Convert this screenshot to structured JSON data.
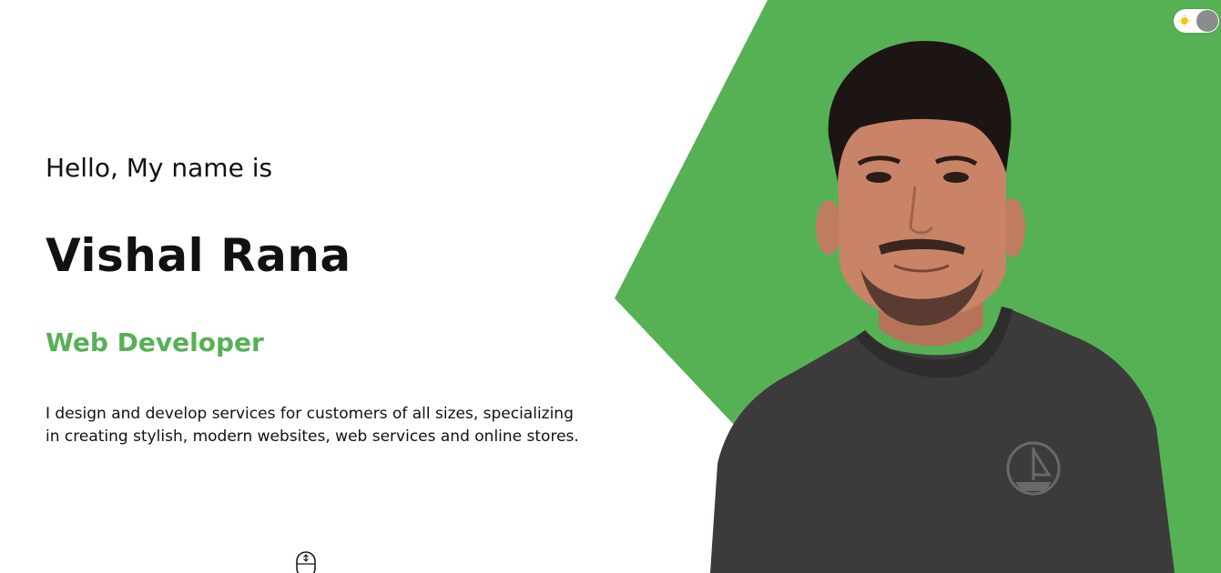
{
  "hero": {
    "greeting": "Hello, My name is",
    "name": "Vishal Rana",
    "role": "Web Developer",
    "description": "I design and develop services for customers of all sizes, specializing in creating stylish, modern websites, web services and online stores."
  },
  "theme_toggle": {
    "icon": "sun-icon",
    "state": "light"
  },
  "scroll_indicator": {
    "icon": "mouse-scroll-icon"
  },
  "colors": {
    "accent": "#56b155",
    "text": "#111111",
    "background": "#ffffff",
    "shirt": "#3d3a3c",
    "toggle_knob": "#8c8c8c"
  }
}
